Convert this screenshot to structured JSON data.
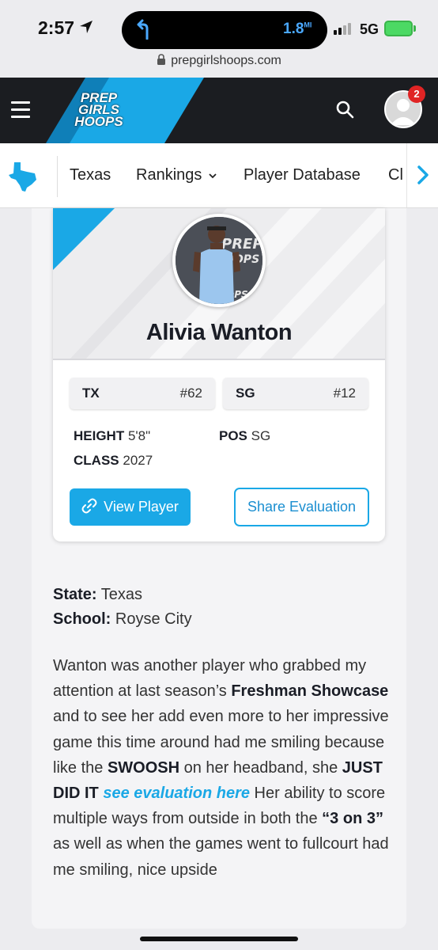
{
  "status_bar": {
    "time": "2:57",
    "island_distance": "1.8",
    "island_unit": "MI",
    "network": "5G",
    "battery_color": "#4cd964"
  },
  "browser": {
    "url": "prepgirlshoops.com"
  },
  "header": {
    "logo": [
      "PREP",
      "GIRLS",
      "HOOPS"
    ],
    "notification_count": "2",
    "brand_color": "#1aa8e6"
  },
  "nav": {
    "items": [
      {
        "label": "Texas"
      },
      {
        "label": "Rankings"
      },
      {
        "label": "Player Database"
      },
      {
        "label": "Cl"
      }
    ]
  },
  "player": {
    "name": "Alivia Wanton",
    "ranks": [
      {
        "label": "TX",
        "value": "#62"
      },
      {
        "label": "SG",
        "value": "#12"
      }
    ],
    "stats": [
      {
        "label": "HEIGHT",
        "value": "5'8\""
      },
      {
        "label": "POS",
        "value": "SG"
      },
      {
        "label": "CLASS",
        "value": "2027"
      }
    ],
    "view_button": "View Player",
    "share_button": "Share Evaluation"
  },
  "info": {
    "state_label": "State:",
    "state_value": "Texas",
    "school_label": "School:",
    "school_value": "Royse City"
  },
  "article": {
    "p1": "Wanton was another player who grabbed my attention at last season’s ",
    "b1": "Freshman Showcase",
    "p2": " and to see her add even more to her impressive game this time around had me smiling because like the ",
    "b2": "SWOOSH",
    "p3": " on her headband, she ",
    "b3": "JUST DID IT",
    "link": "see evaluation here",
    "p4": " Her ability to score multiple ways from outside in both the ",
    "b4": "“3 on 3”",
    "p5": " as well as when the games went to fullcourt had me smiling, nice upside"
  }
}
